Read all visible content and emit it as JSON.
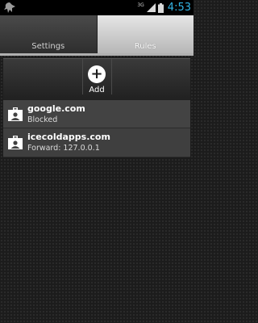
{
  "status_bar": {
    "network": "3G",
    "time": "4:53"
  },
  "tabs": [
    {
      "label": "Settings",
      "active": false
    },
    {
      "label": "Rules",
      "active": true
    }
  ],
  "toolbar": {
    "add_label": "Add",
    "add_icon": "plus-circle-icon"
  },
  "rules": [
    {
      "host": "google.com",
      "status": "Blocked",
      "icon": "contact-card-icon"
    },
    {
      "host": "icecoldapps.com",
      "status": "Forward: 127.0.0.1",
      "icon": "contact-card-icon"
    }
  ],
  "colors": {
    "clock": "#33b5e5",
    "active_tab": "#d0d0d0",
    "row": "#434343"
  }
}
